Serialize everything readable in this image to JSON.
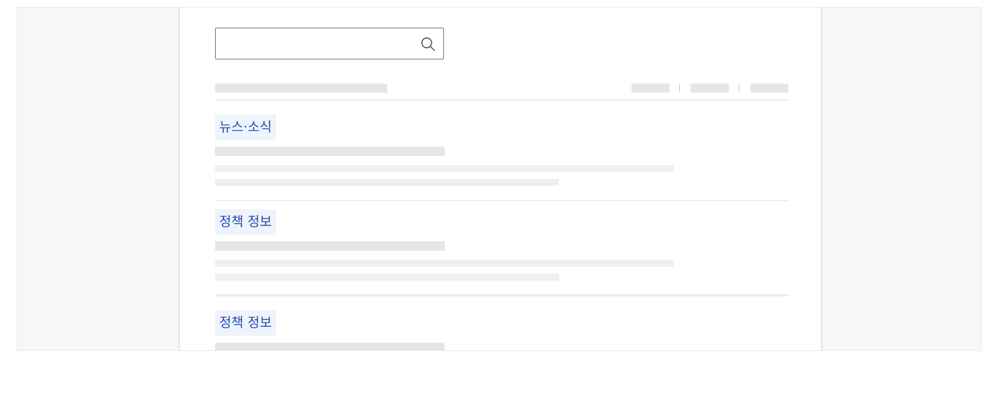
{
  "search": {
    "value": "",
    "placeholder": "",
    "icon": "search-icon"
  },
  "sections": [
    {
      "category": "뉴스·소식"
    },
    {
      "category": "정책 정보"
    },
    {
      "category": "정책 정보"
    }
  ],
  "colors": {
    "tag_text": "#1f4fb3",
    "tag_bg": "#eef3fc",
    "skeleton": "#e6e6e6",
    "page_bg": "#f7f7f7"
  }
}
